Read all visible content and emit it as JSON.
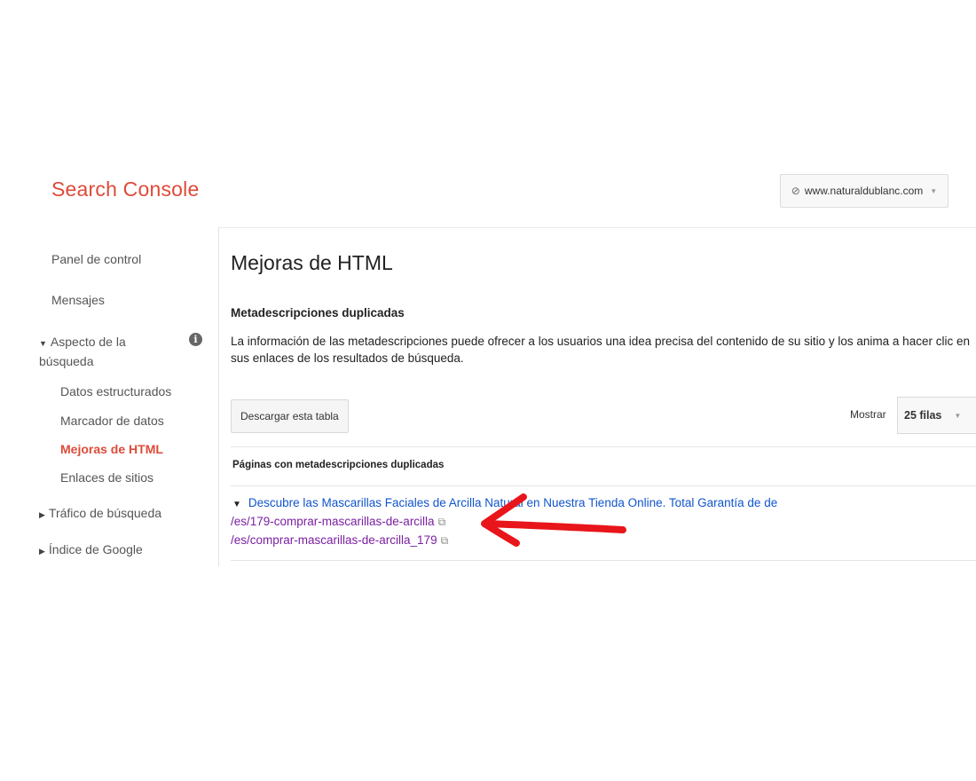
{
  "app": {
    "brand": "Search Console"
  },
  "site_selector": {
    "value": "www.naturaldublanc.com",
    "icon": "link-icon"
  },
  "sidebar": {
    "items": [
      {
        "label": "Panel de control"
      },
      {
        "label": "Mensajes"
      },
      {
        "label": "Aspecto de la búsqueda",
        "expanded": true
      },
      {
        "label": "Datos estructurados"
      },
      {
        "label": "Marcador de datos"
      },
      {
        "label": "Mejoras de HTML",
        "active": true
      },
      {
        "label": "Enlaces de sitios"
      },
      {
        "label": "Tráfico de búsqueda"
      },
      {
        "label": "Índice de Google"
      }
    ]
  },
  "main": {
    "title": "Mejoras de HTML",
    "section_title": "Metadescripciones duplicadas",
    "description": "La información de las metadescripciones puede ofrecer a los usuarios una idea precisa del contenido de su sitio y los anima a hacer clic en sus enlaces de los resultados de búsqueda.",
    "download_button": "Descargar esta tabla",
    "show_label": "Mostrar",
    "rows_select": "25 filas",
    "table_header": "Páginas con metadescripciones duplicadas",
    "group": {
      "description": "Descubre las Mascarillas Faciales de Arcilla Natural en Nuestra Tienda Online. Total Garantía de de",
      "urls": [
        "/es/179-comprar-mascarillas-de-arcilla",
        "/es/comprar-mascarillas-de-arcilla_179"
      ]
    }
  },
  "colors": {
    "brand": "#dd4b39",
    "link": "#1155cc",
    "visited": "#7b1fa2",
    "annotation": "#e8151b"
  }
}
